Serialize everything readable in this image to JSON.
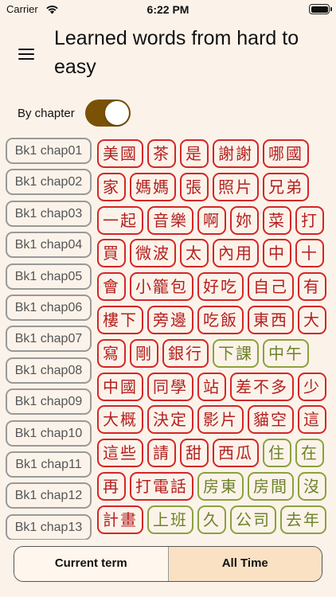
{
  "status": {
    "carrier": "Carrier",
    "time": "6:22 PM"
  },
  "title": "Learned words from hard to easy",
  "toggle": {
    "label": "By chapter",
    "on": true
  },
  "chapters": [
    "Bk1 chap01",
    "Bk1 chap02",
    "Bk1 chap03",
    "Bk1 chap04",
    "Bk1 chap05",
    "Bk1 chap06",
    "Bk1 chap07",
    "Bk1 chap08",
    "Bk1 chap09",
    "Bk1 chap10",
    "Bk1 chap11",
    "Bk1 chap12",
    "Bk1 chap13"
  ],
  "rows": [
    [
      "美國",
      "茶",
      "是",
      "謝謝",
      "哪國"
    ],
    [
      "家",
      "媽媽",
      "張",
      "照片",
      "兄弟"
    ],
    [
      "一起",
      "音樂",
      "啊",
      "妳",
      "菜",
      "打"
    ],
    [
      "買",
      "微波",
      "太",
      "內用",
      "中",
      "十"
    ],
    [
      "會",
      "小籠包",
      "好吃",
      "自己",
      "有"
    ],
    [
      "樓下",
      "旁邊",
      "吃飯",
      "東西",
      "大"
    ],
    [
      "寫",
      "剛",
      "銀行",
      "下課",
      "中午"
    ],
    [
      "中國",
      "同學",
      "站",
      "差不多",
      "少"
    ],
    [
      "大概",
      "決定",
      "影片",
      "貓空",
      "這"
    ],
    [
      "這些",
      "請",
      "甜",
      "西瓜",
      "住",
      "在"
    ],
    [
      "再",
      "打電話",
      "房東",
      "房間",
      "沒"
    ],
    [
      "計畫",
      "上班",
      "久",
      "公司",
      "去年"
    ]
  ],
  "levels": [
    [
      1,
      1,
      1,
      1,
      1
    ],
    [
      1,
      1,
      1,
      1,
      1
    ],
    [
      1,
      1,
      1,
      1,
      1,
      1
    ],
    [
      1,
      1,
      1,
      1,
      1,
      1
    ],
    [
      1,
      1,
      1,
      1,
      1
    ],
    [
      1,
      1,
      1,
      1,
      1
    ],
    [
      1,
      1,
      1,
      4,
      4
    ],
    [
      1,
      1,
      1,
      1,
      1
    ],
    [
      1,
      1,
      1,
      1,
      1
    ],
    [
      1,
      1,
      1,
      1,
      4,
      4
    ],
    [
      1,
      1,
      4,
      4,
      4
    ],
    [
      1,
      4,
      4,
      4,
      4
    ]
  ],
  "segments": {
    "current": "Current term",
    "all": "All Time",
    "active": "all"
  },
  "colors": {
    "accent": "#7a5206",
    "hard": "#d42626",
    "easy": "#8ca13c",
    "background": "#fbf3ea"
  }
}
